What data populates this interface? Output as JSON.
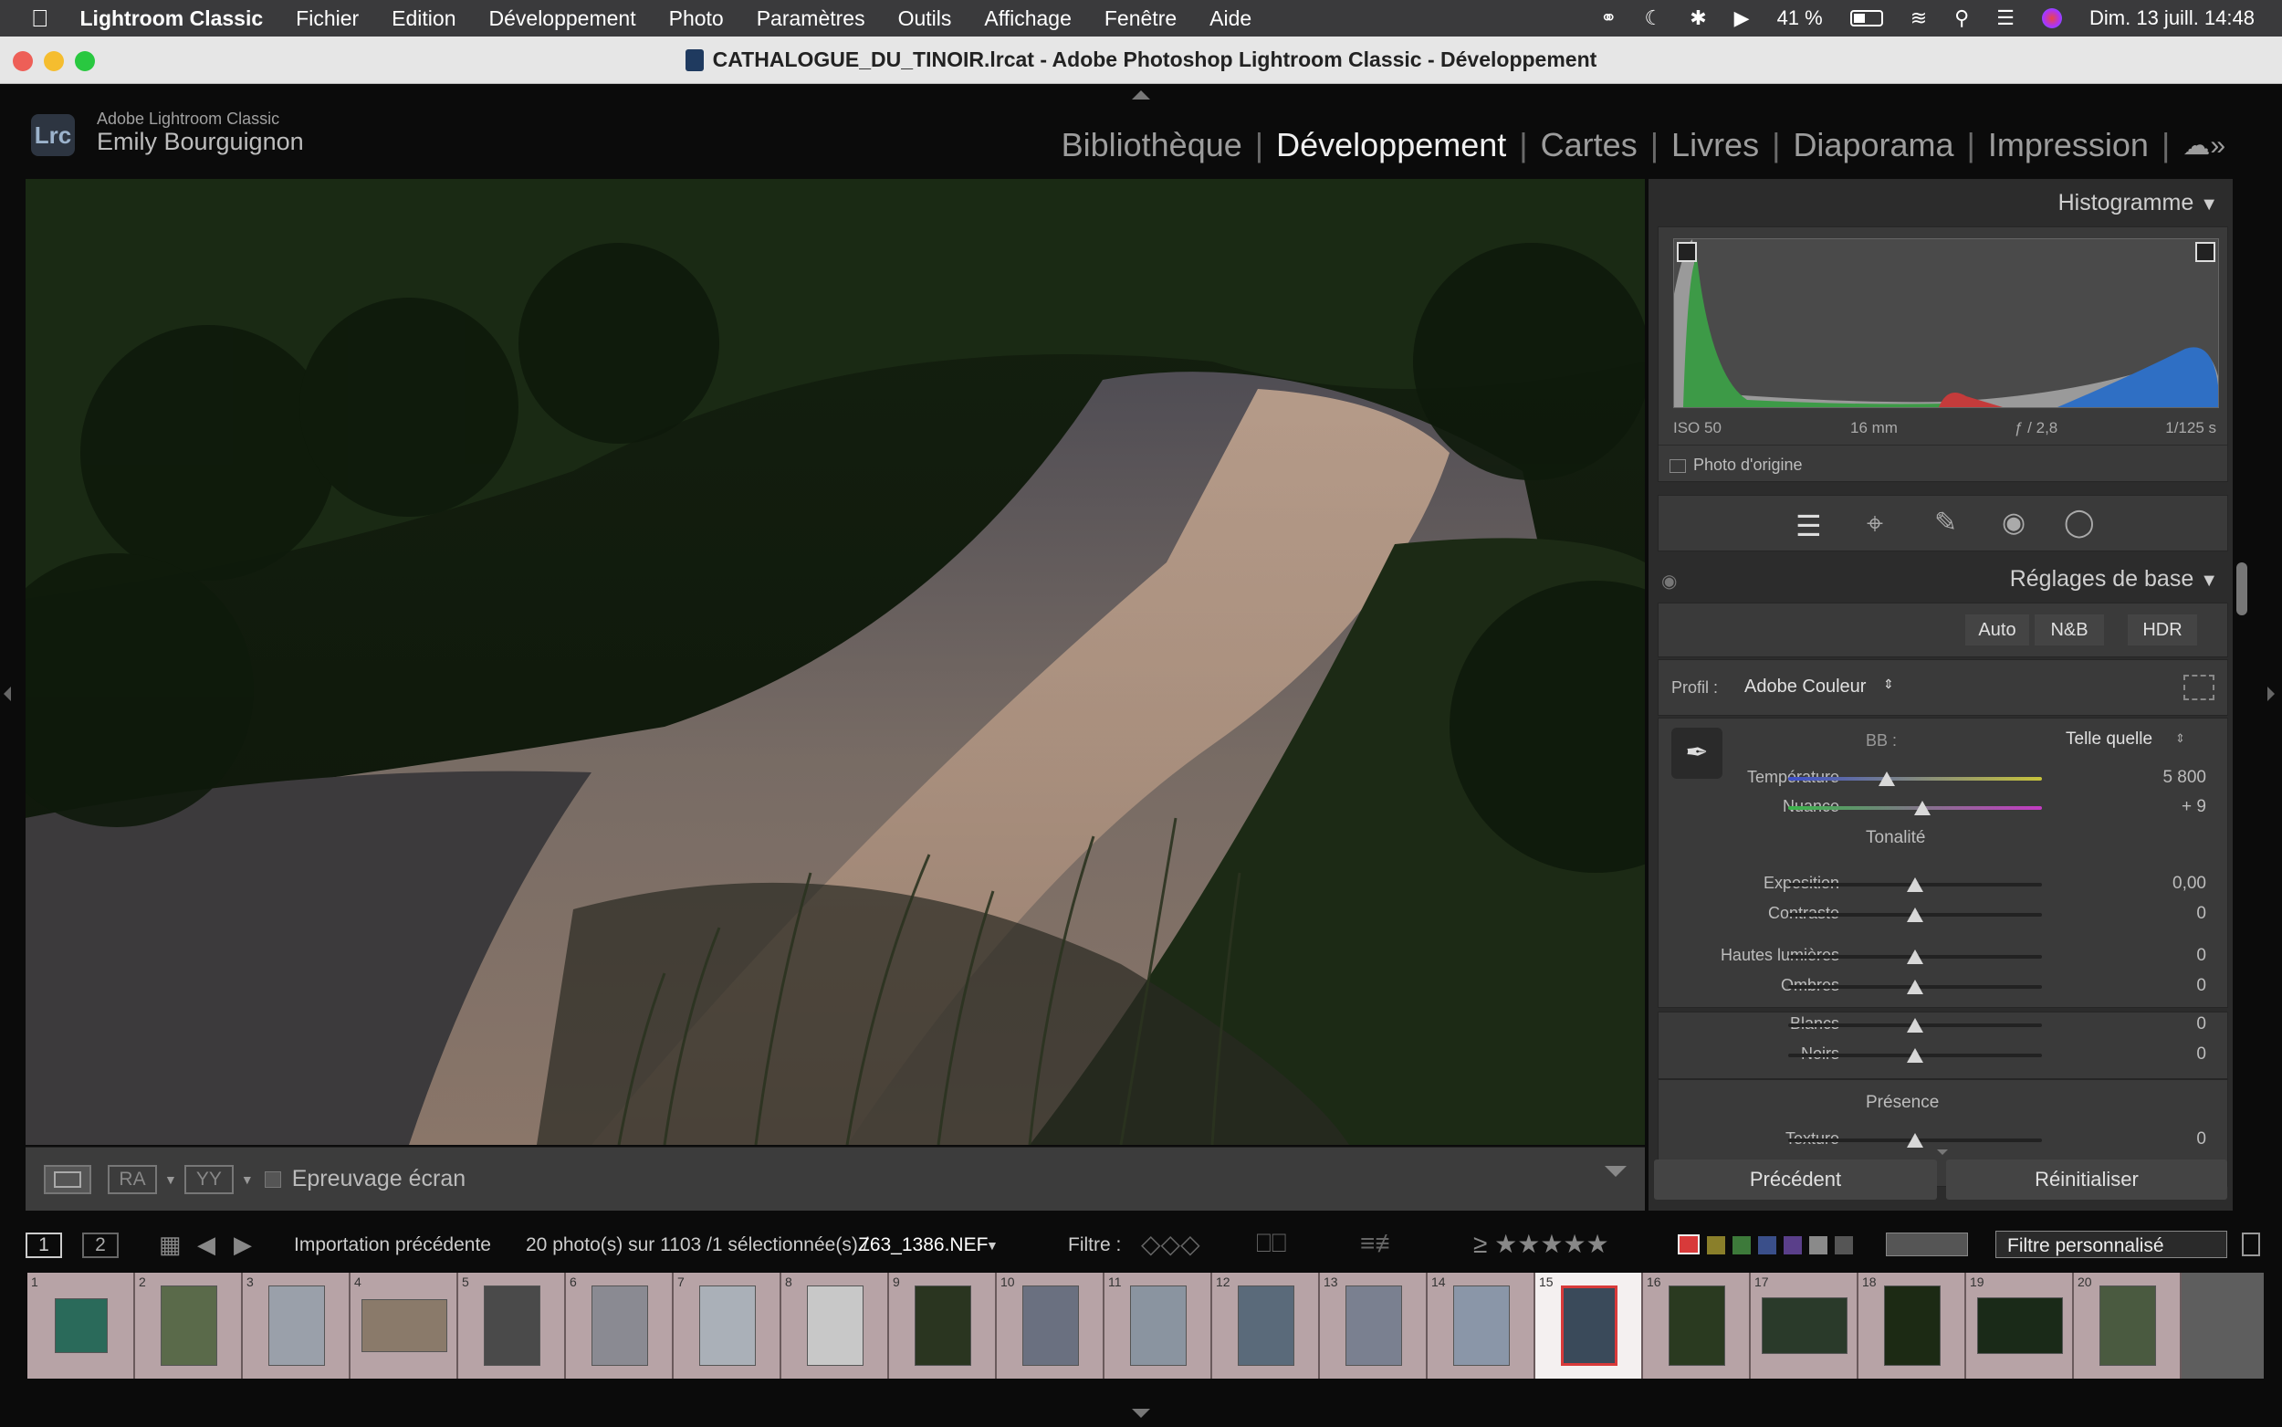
{
  "menubar": {
    "app_name": "Lightroom Classic",
    "items": [
      "Fichier",
      "Edition",
      "Développement",
      "Photo",
      "Paramètres",
      "Outils",
      "Affichage",
      "Fenêtre",
      "Aide"
    ],
    "battery": "41 %",
    "datetime": "Dim. 13 juill. 14:48"
  },
  "window": {
    "title": "CATHALOGUE_DU_TINOIR.lrcat - Adobe Photoshop Lightroom Classic - Développement"
  },
  "identity": {
    "badge": "Lrc",
    "product": "Adobe Lightroom Classic",
    "user": "Emily Bourguignon"
  },
  "modules": [
    "Bibliothèque",
    "Développement",
    "Cartes",
    "Livres",
    "Diaporama",
    "Impression"
  ],
  "active_module": "Développement",
  "toolbar": {
    "view_a": "RA",
    "view_b": "YY",
    "proof_label": "Epreuvage écran"
  },
  "histogram": {
    "title": "Histogramme",
    "iso": "ISO 50",
    "focal": "16 mm",
    "aperture": "ƒ / 2,8",
    "shutter": "1/125 s",
    "original": "Photo d'origine"
  },
  "basic": {
    "title": "Réglages de base",
    "auto": "Auto",
    "bw": "N&B",
    "hdr": "HDR",
    "profile_label": "Profil :",
    "profile_value": "Adobe Couleur",
    "wb_label": "BB :",
    "wb_value": "Telle quelle",
    "temperature": {
      "label": "Température",
      "value": "5 800",
      "pos": 0.39
    },
    "tint": {
      "label": "Nuance",
      "value": "+ 9",
      "pos": 0.53
    },
    "tone_title": "Tonalité",
    "sliders_tone": [
      {
        "label": "Exposition",
        "value": "0,00",
        "pos": 0.5
      },
      {
        "label": "Contraste",
        "value": "0",
        "pos": 0.5
      }
    ],
    "sliders_light": [
      {
        "label": "Hautes lumières",
        "value": "0",
        "pos": 0.5
      },
      {
        "label": "Ombres",
        "value": "0",
        "pos": 0.5
      },
      {
        "label": "Blancs",
        "value": "0",
        "pos": 0.5
      },
      {
        "label": "Noirs",
        "value": "0",
        "pos": 0.5
      }
    ],
    "presence_title": "Présence",
    "texture": {
      "label": "Texture",
      "value": "0",
      "pos": 0.5
    }
  },
  "panel_buttons": {
    "previous": "Précédent",
    "reset": "Réinitialiser"
  },
  "filmstrip_bar": {
    "screen1": "1",
    "screen2": "2",
    "source": "Importation précédente",
    "count": "20 photo(s) sur 1103 /1 sélectionnée(s) /",
    "filename": "Z63_1386.NEF",
    "filter_label": "Filtre :",
    "filter_value": "Filtre personnalisé"
  },
  "filmstrip": {
    "numbers": [
      "1",
      "2",
      "3",
      "4",
      "5",
      "6",
      "7",
      "8",
      "9",
      "10",
      "11",
      "12",
      "13",
      "14",
      "15",
      "16",
      "17",
      "18",
      "19",
      "20"
    ],
    "selected": 15
  },
  "colors": {
    "accent_red": "#d83a3a"
  }
}
